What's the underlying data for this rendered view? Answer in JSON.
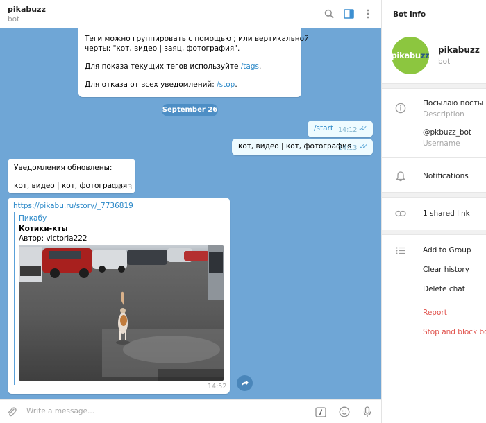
{
  "chat": {
    "title": "pikabuzz",
    "status": "bot"
  },
  "header_icons": [
    "search-icon",
    "sidebar-toggle-icon",
    "more-vertical-icon"
  ],
  "messages": {
    "m1": {
      "line1": "Теги можно группировать с помощью ; или вертикальной",
      "line2": "черты: \"кот, видео | заяц, фотография\".",
      "line3_prefix": "Для показа текущих тегов используйте ",
      "line3_link": "/tags",
      "line3_suffix": ".",
      "line4_prefix": "Для отказа от всех уведомлений: ",
      "line4_link": "/stop",
      "line4_suffix": "."
    },
    "date_separator": "September 26",
    "m2": {
      "text": "/start",
      "time": "14:12"
    },
    "m3": {
      "text": "кот, видео | кот, фотография",
      "time": "14:13"
    },
    "m4": {
      "line1": "Уведомления обновлены:",
      "line2": "кот, видео | кот, фотография",
      "time": "14:13"
    },
    "m5": {
      "url": "https://pikabu.ru/story/_7736819",
      "site": "Пикабу",
      "title": "Котики-кты",
      "author": "Автор: victoria222",
      "time": "14:52"
    }
  },
  "input": {
    "placeholder": "Write a message..."
  },
  "input_icons": [
    "attach-icon",
    "commands-icon",
    "emoji-icon",
    "microphone-icon"
  ],
  "bot_info": {
    "panel_title": "Bot Info",
    "avatar_text_main": "pikabu",
    "avatar_text_accent": "zz",
    "name": "pikabuzz",
    "type": "bot",
    "description": "Посылаю посты с П",
    "description_label": "Description",
    "username": "@pkbuzz_bot",
    "username_label": "Username",
    "notifications": "Notifications",
    "shared_links": "1 shared link",
    "actions": {
      "add_to_group": "Add to Group",
      "clear_history": "Clear history",
      "delete_chat": "Delete chat",
      "report": "Report",
      "stop_block": "Stop and block bot"
    }
  },
  "colors": {
    "chat_background": "#6fa6d6",
    "outgoing_bubble": "#eefbff",
    "link": "#2a88c8",
    "avatar_green": "#8cc63f",
    "danger": "#e0504a"
  }
}
